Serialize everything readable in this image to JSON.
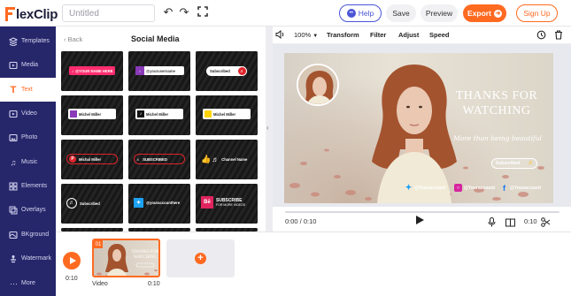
{
  "app": {
    "logo_text": "lexClip"
  },
  "header": {
    "title_placeholder": "Untitled",
    "help_label": "Help",
    "save_label": "Save",
    "preview_label": "Preview",
    "export_label": "Export",
    "signup_label": "Sign Up"
  },
  "sidebar": {
    "items": [
      {
        "label": "Templates",
        "icon": "templates-icon"
      },
      {
        "label": "Media",
        "icon": "media-icon"
      },
      {
        "label": "Text",
        "icon": "text-icon",
        "active": true
      },
      {
        "label": "Video",
        "icon": "video-icon"
      },
      {
        "label": "Photo",
        "icon": "photo-icon"
      },
      {
        "label": "Music",
        "icon": "music-icon"
      },
      {
        "label": "Elements",
        "icon": "elements-icon"
      },
      {
        "label": "Overlays",
        "icon": "overlays-icon"
      },
      {
        "label": "BKground",
        "icon": "background-icon"
      },
      {
        "label": "Watermark",
        "icon": "watermark-icon"
      },
      {
        "label": "More",
        "icon": "more-icon"
      }
    ]
  },
  "panel": {
    "back_label": "Back",
    "title": "Social Media",
    "tiles": {
      "t1": "@YOUR NAME HERE",
      "t2": "@yourusername",
      "t3": "Subscribed",
      "t4": "Michel Miller",
      "t5": "Michel Miller",
      "t6": "Michel Miller",
      "t7": "Michal Miller",
      "t8": "SUBSCRIBED",
      "t9": "Channel Name",
      "t10": "Subscribed",
      "t11": "@youraccounthere",
      "t12a": "SUBSCRIBE",
      "t12b": "FOR MORE VIDEOS"
    }
  },
  "editor": {
    "zoom": "100%",
    "tools": [
      "Transform",
      "Filter",
      "Adjust",
      "Speed"
    ],
    "canvas": {
      "title_line1": "THANKS FOR",
      "title_line2": "WATCHING",
      "subtitle": "More than being beautiful",
      "subscribe_chip": "Subscribed",
      "social": [
        {
          "icon": "twitter-icon",
          "handle": "@Youraccount",
          "color": "#1da1f2"
        },
        {
          "icon": "instagram-icon",
          "handle": "@Youraccount",
          "color": "#d6249f"
        },
        {
          "icon": "facebook-icon",
          "handle": "@Youraccount",
          "color": "#1877f2"
        }
      ]
    },
    "time_current": "0:00 / 0:10",
    "duration_right": "0:10"
  },
  "timeline": {
    "time": "0:10",
    "clip_number": "01",
    "clip_label": "Video",
    "clip_duration": "0:10"
  }
}
